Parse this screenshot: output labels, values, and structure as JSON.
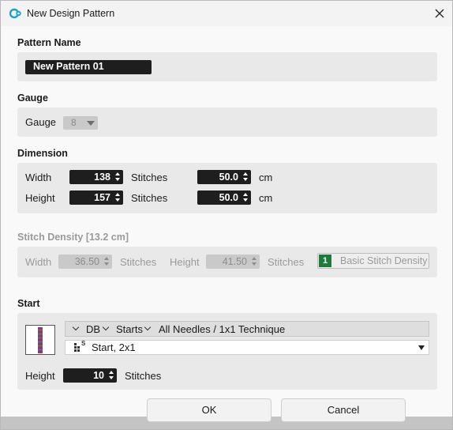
{
  "window": {
    "title": "New Design Pattern"
  },
  "pattern_name": {
    "label": "Pattern Name",
    "value": "New Pattern 01"
  },
  "gauge": {
    "section": "Gauge",
    "label": "Gauge",
    "value": "8"
  },
  "dimension": {
    "section": "Dimension",
    "width": {
      "label": "Width",
      "stitches": "138",
      "stitches_unit": "Stitches",
      "cm": "50.0",
      "cm_unit": "cm"
    },
    "height": {
      "label": "Height",
      "stitches": "157",
      "stitches_unit": "Stitches",
      "cm": "50.0",
      "cm_unit": "cm"
    }
  },
  "stitch_density": {
    "section": "Stitch Density [13.2 cm]",
    "width_label": "Width",
    "width_value": "36.50",
    "width_unit": "Stitches",
    "height_label": "Height",
    "height_value": "41.50",
    "height_unit": "Stitches",
    "button_badge": "1",
    "button_label": "Basic Stitch Density"
  },
  "start": {
    "section": "Start",
    "db_label": "DB",
    "starts_label": "Starts",
    "technique": "All Needles / 1x1 Technique",
    "start_value": "Start, 2x1",
    "start_icon_sup": "S",
    "height_label": "Height",
    "height_value": "10",
    "height_unit": "Stitches"
  },
  "buttons": {
    "ok": "OK",
    "cancel": "Cancel"
  },
  "colors": {
    "accent_teal": "#1aa3c8",
    "badge_green": "#1d7a3a",
    "field_dark": "#1e1e1e"
  }
}
